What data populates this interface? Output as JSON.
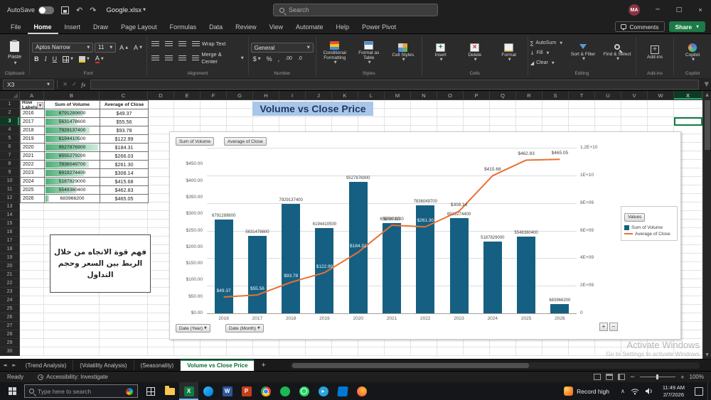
{
  "titlebar": {
    "autosave_label": "AutoSave",
    "filename": "Google.xlsx",
    "search_placeholder": "Search",
    "avatar_initials": "MA"
  },
  "ribbon": {
    "tabs": [
      "File",
      "Home",
      "Insert",
      "Draw",
      "Page Layout",
      "Formulas",
      "Data",
      "Review",
      "View",
      "Automate",
      "Help",
      "Power Pivot"
    ],
    "active_tab": "Home",
    "comments_label": "Comments",
    "share_label": "Share",
    "groups": {
      "clipboard": {
        "paste": "Paste",
        "label": "Clipboard"
      },
      "font": {
        "name": "Aptos Narrow",
        "size": "11",
        "label": "Font"
      },
      "alignment": {
        "wrap": "Wrap Text",
        "merge": "Merge & Center",
        "label": "Alignment"
      },
      "number": {
        "format": "General",
        "label": "Number"
      },
      "styles": {
        "conditional": "Conditional Formatting",
        "table": "Format as Table",
        "cellstyles": "Cell Styles",
        "label": "Styles"
      },
      "cells": {
        "insert": "Insert",
        "delete": "Delete",
        "format": "Format",
        "label": "Cells"
      },
      "editing": {
        "autosum": "AutoSum",
        "fill": "Fill",
        "clear": "Clear",
        "sort": "Sort & Filter",
        "find": "Find & Select",
        "label": "Editing"
      },
      "addins": {
        "label": "Add-ins"
      },
      "copilot": {
        "label": "Copilot"
      }
    }
  },
  "formula_bar": {
    "name_box": "X3"
  },
  "grid": {
    "columns": [
      "A",
      "B",
      "C",
      "D",
      "E",
      "F",
      "G",
      "H",
      "I",
      "J",
      "K",
      "L",
      "M",
      "N",
      "O",
      "P",
      "Q",
      "R",
      "S",
      "T",
      "U",
      "V",
      "W",
      "X"
    ],
    "row_count": 30,
    "selected_col": "X",
    "selected_row": 3
  },
  "pivot_table": {
    "headers": [
      "Row Labels",
      "Sum of Volume",
      "Average of Close"
    ],
    "rows": [
      {
        "year": "2016",
        "volume": "6791289800",
        "close": "$49.37"
      },
      {
        "year": "2017",
        "volume": "5631478600",
        "close": "$55.56"
      },
      {
        "year": "2018",
        "volume": "7929137400",
        "close": "$93.78"
      },
      {
        "year": "2019",
        "volume": "6194410500",
        "close": "$122.99"
      },
      {
        "year": "2020",
        "volume": "9527876900",
        "close": "$184.31"
      },
      {
        "year": "2021",
        "volume": "6555279200",
        "close": "$266.03"
      },
      {
        "year": "2022",
        "volume": "7836049700",
        "close": "$261.30"
      },
      {
        "year": "2023",
        "volume": "6919274400",
        "close": "$308.14"
      },
      {
        "year": "2024",
        "volume": "5187829000",
        "close": "$415.68"
      },
      {
        "year": "2025",
        "volume": "5548360400",
        "close": "$462.83"
      },
      {
        "year": "2026",
        "volume": "683966200",
        "close": "$465.05"
      }
    ]
  },
  "annotation": {
    "lines": [
      "فهم قوة الاتجاه من خلال",
      "الربط بين السعر وحجم",
      "التداول"
    ]
  },
  "chart_data": {
    "type": "bar",
    "combo": "clustered column + line",
    "title": "Volume vs Close Price",
    "categories": [
      "2016",
      "2017",
      "2018",
      "2019",
      "2020",
      "2021",
      "2022",
      "2023",
      "2024",
      "2025",
      "2026"
    ],
    "series": [
      {
        "name": "Sum of Volume",
        "type": "bar",
        "axis": "secondary",
        "color": "#156082",
        "values": [
          6791289800,
          5631478600,
          7929137400,
          6194410500,
          9527876900,
          6555279200,
          7836049700,
          6919274400,
          5187829000,
          5548360400,
          683966200
        ]
      },
      {
        "name": "Average of Close",
        "type": "line",
        "axis": "primary",
        "color": "#E97132",
        "values": [
          49.37,
          55.56,
          93.78,
          122.99,
          184.31,
          266.03,
          261.3,
          308.14,
          415.68,
          462.83,
          465.05
        ]
      }
    ],
    "left_axis": {
      "min": 0,
      "max": 500,
      "labels": [
        "$0.00",
        "$50.00",
        "$100.00",
        "$150.00",
        "$200.00",
        "$250.00",
        "$300.00",
        "$350.00",
        "$400.00",
        "$450.00"
      ]
    },
    "right_axis": {
      "min": 0,
      "max": 12000000000,
      "labels": [
        "0",
        "2E+09",
        "4E+09",
        "6E+09",
        "8E+09",
        "1E+10",
        "1.2E+10"
      ]
    },
    "legend": {
      "title": "Values",
      "entries": [
        "Sum of Volume",
        "Average of Close"
      ],
      "position": "right"
    },
    "field_buttons_top": [
      "Sum of Volume",
      "Average of Close"
    ],
    "field_buttons_bottom": [
      "Date (Year)",
      "Date (Month)"
    ],
    "grid": true
  },
  "sheet_tabs": {
    "tabs": [
      "(Trend Analysis)",
      "(Volatility Analysis)",
      "(Seasonality)",
      "Volume vs Close Price"
    ],
    "active": "Volume vs Close Price"
  },
  "status_bar": {
    "mode": "Ready",
    "accessibility": "Accessibility: Investigate",
    "zoom": "100%"
  },
  "watermark": {
    "line1": "Activate Windows",
    "line2": "Go to Settings to activate Windows"
  },
  "taskbar": {
    "search_placeholder": "Type here to search",
    "icons": [
      "task-view",
      "file-explorer",
      "excel",
      "edge",
      "word",
      "powerpoint",
      "chrome",
      "spotify",
      "whatsapp",
      "telegram",
      "vscode",
      "firefox"
    ],
    "weather": "Record high",
    "time": "11:49 AM",
    "date": "2/7/2026"
  }
}
